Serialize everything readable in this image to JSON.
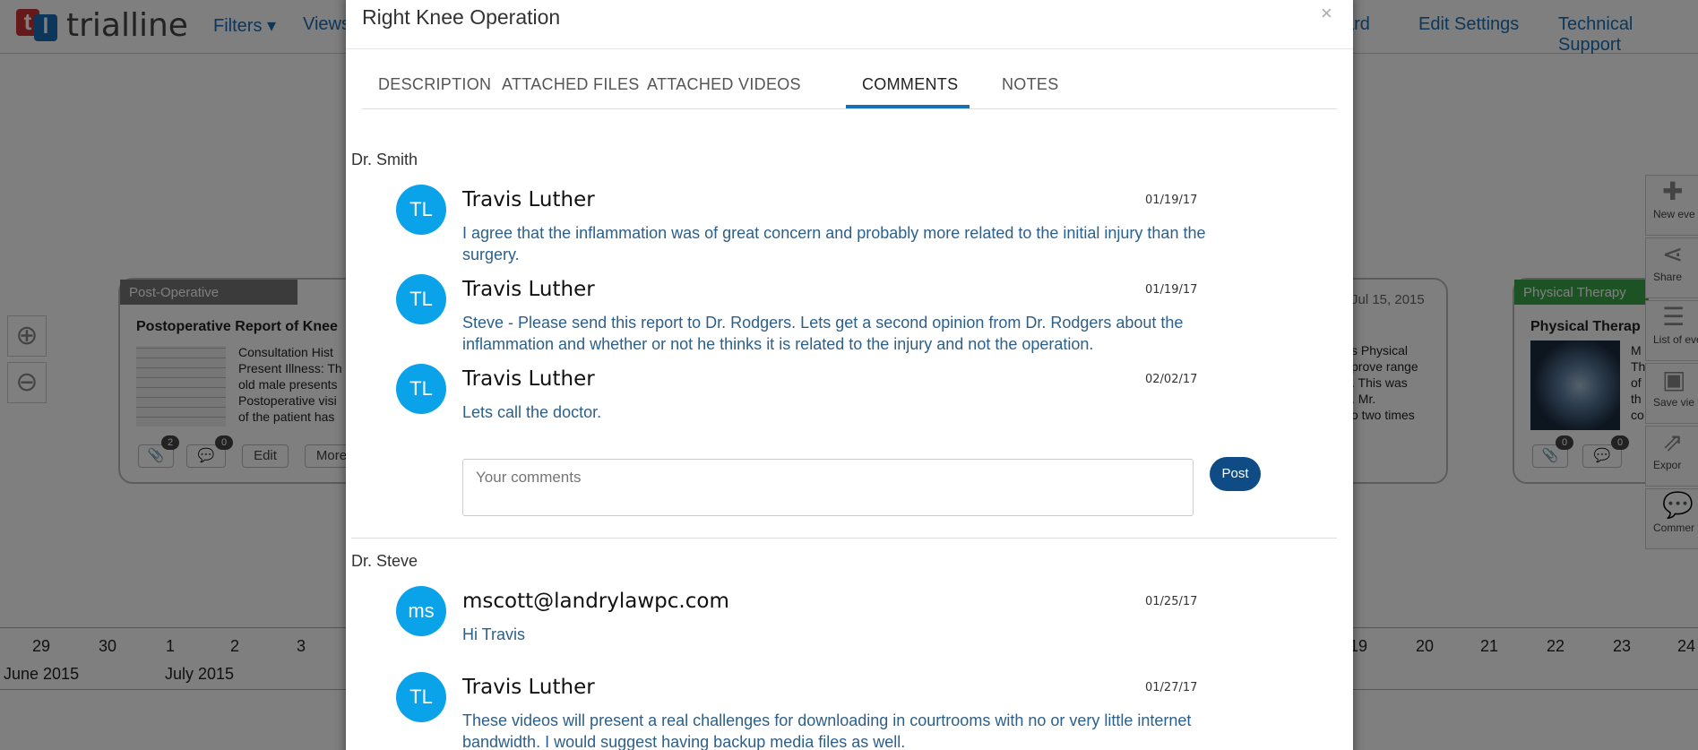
{
  "app": {
    "logo_text": "trialline",
    "logo_t": "t",
    "logo_l": "l"
  },
  "topnav": {
    "filters": "Filters ▾",
    "views": "Views",
    "dashboard_partial": "ard",
    "edit_settings": "Edit Settings",
    "technical_support": "Technical Support"
  },
  "timeline": {
    "ticks": [
      "29",
      "30",
      "1",
      "2",
      "3",
      "19",
      "20",
      "21",
      "22",
      "23",
      "24"
    ],
    "months": [
      "June 2015",
      "July 2015"
    ],
    "card_left": {
      "category": "Post-Operative",
      "category_color": "#777777",
      "title": "Postoperative Report of Knee",
      "text": "Consultation Hist\nPresent Illness: Th\nold male presents\nPostoperative visi\nof the patient has",
      "attach_count": "2",
      "comment_count": "0",
      "edit_label": "Edit",
      "more_label": "More"
    },
    "card_mid": {
      "date": "Jul 15, 2015",
      "text": "s Physical\nprove range\n. This was\n. Mr.\no two times"
    },
    "card_right": {
      "category": "Physical Therapy",
      "category_color": "#3aa648",
      "title": "Physical Therap",
      "text": "M\nTh\nof\nth\nco",
      "attach_count": "0",
      "comment_count": "0"
    },
    "side_tools": [
      "New eve",
      "Share",
      "List of eve",
      "Save vie",
      "Expor",
      "Commer"
    ]
  },
  "modal": {
    "title": "Right Knee Operation",
    "close": "×",
    "tabs": [
      "DESCRIPTION",
      "ATTACHED FILES",
      "ATTACHED VIDEOS",
      "COMMENTS",
      "NOTES"
    ],
    "active_tab": "COMMENTS",
    "sections": [
      {
        "heading": "Dr. Smith",
        "comments": [
          {
            "initials": "TL",
            "author": "Travis Luther",
            "date": "01/19/17",
            "text": "I agree that the inflammation was of great concern and probably more related to the initial injury than the surgery."
          },
          {
            "initials": "TL",
            "author": "Travis Luther",
            "date": "01/19/17",
            "text": "Steve - Please send this report to Dr. Rodgers. Lets get a second opinion from Dr. Rodgers about the inflammation and whether or not he thinks it is related to the injury and not the operation."
          },
          {
            "initials": "TL",
            "author": "Travis Luther",
            "date": "02/02/17",
            "text": "Lets call the doctor."
          }
        ],
        "input_placeholder": "Your comments",
        "post_label": "Post"
      },
      {
        "heading": "Dr. Steve",
        "comments": [
          {
            "initials": "ms",
            "author": "mscott@landrylawpc.com",
            "date": "01/25/17",
            "text": "Hi Travis"
          },
          {
            "initials": "TL",
            "author": "Travis Luther",
            "date": "01/27/17",
            "text": "These videos will present a real challenges for downloading in courtrooms with no or very little internet bandwidth. I would suggest having backup media files as well."
          }
        ]
      }
    ]
  },
  "colors": {
    "accent": "#1b6fb5",
    "avatar": "#0aa2e8",
    "post_button": "#0f4c85",
    "comment_text": "#2c5f8a"
  }
}
